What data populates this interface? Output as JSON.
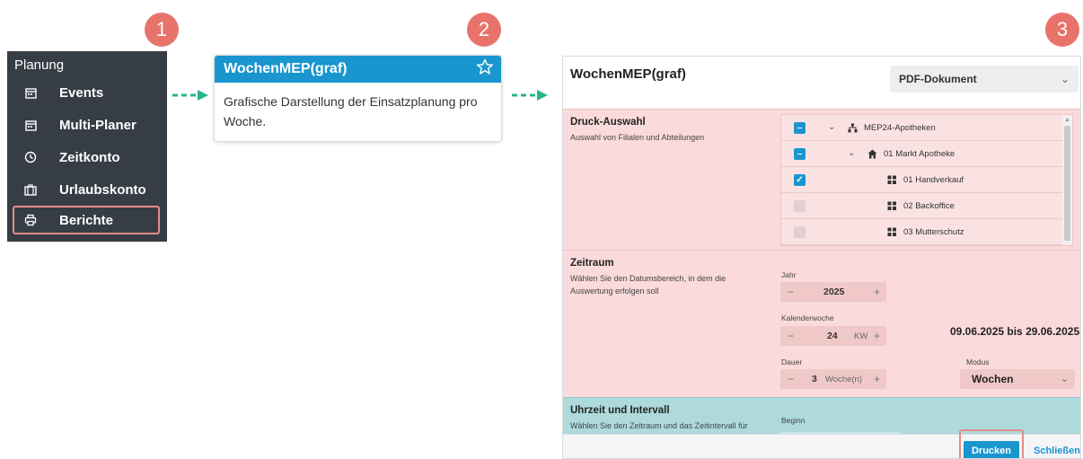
{
  "steps": [
    "1",
    "2",
    "3"
  ],
  "colors": {
    "accent": "#1a96cf",
    "badge": "#e8736b",
    "highlight": "#e38d88",
    "arrow": "#27b58e",
    "sidebar_bg": "#363d45",
    "pink_section": "#fadada",
    "teal_section": "#aedadc"
  },
  "sidebar": {
    "section_title": "Planung",
    "items": [
      {
        "label": "Events",
        "icon": "calendar-icon"
      },
      {
        "label": "Multi-Planer",
        "icon": "calendar-icon"
      },
      {
        "label": "Zeitkonto",
        "icon": "clock-icon"
      },
      {
        "label": "Urlaubskonto",
        "icon": "suitcase-icon"
      },
      {
        "label": "Berichte",
        "icon": "printer-icon",
        "active": true
      }
    ]
  },
  "tile": {
    "title": "WochenMEP(graf)",
    "description": "Grafische Darstellung der Einsatzplanung pro Woche.",
    "icon": "star-icon"
  },
  "dialog": {
    "title": "WochenMEP(graf)",
    "format_select": "PDF-Dokument",
    "druck": {
      "label": "Druck-Auswahl",
      "sub": "Auswahl von Filialen und Abteilungen",
      "tree": [
        {
          "label": "MEP24-Apotheken",
          "state": "partial",
          "level": 0
        },
        {
          "label": "01 Markt Apotheke",
          "state": "partial",
          "level": 1
        },
        {
          "label": "01 Handverkauf",
          "state": "checked",
          "level": 2
        },
        {
          "label": "02 Backoffice",
          "state": "unchecked",
          "level": 2
        },
        {
          "label": "03 Mutterschutz",
          "state": "unchecked",
          "level": 2
        }
      ]
    },
    "zeitraum": {
      "label": "Zeitraum",
      "sub": "Wählen Sie den Datumsbereich, in dem die Auswertung erfolgen soll",
      "jahr_label": "Jahr",
      "jahr": "2025",
      "kw_label": "Kalenderwoche",
      "kw": "24",
      "kw_unit": "KW",
      "dauer_label": "Dauer",
      "dauer": "3",
      "dauer_unit": "Woche(n)",
      "range": "09.06.2025 bis 29.06.2025",
      "modus_label": "Modus",
      "modus": "Wochen"
    },
    "uhrzeit": {
      "label": "Uhrzeit und Intervall",
      "sub": "Wählen Sie den Zeitraum und das Zeitintervall für",
      "beginn_label": "Beginn"
    },
    "print_button": "Drucken",
    "close_button": "Schließen"
  }
}
